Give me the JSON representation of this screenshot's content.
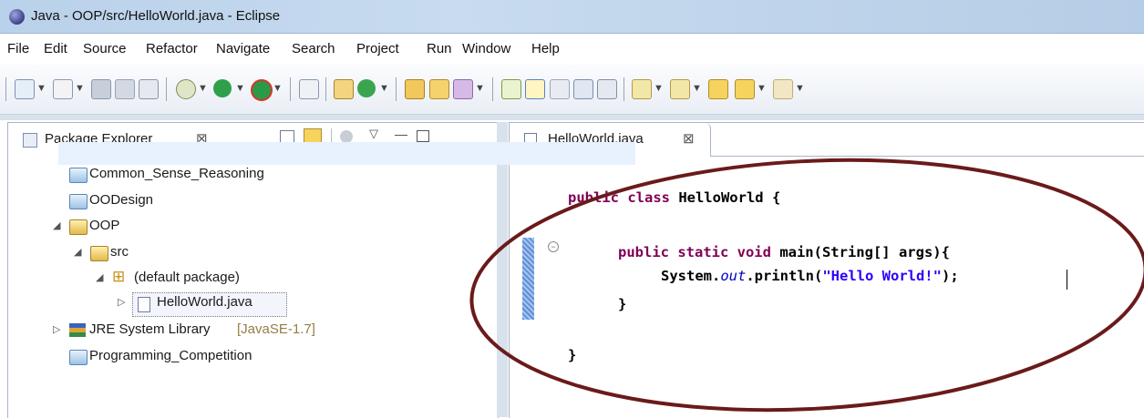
{
  "window": {
    "title": "Java - OOP/src/HelloWorld.java - Eclipse"
  },
  "menu": [
    "File",
    "Edit",
    "Source",
    "Refactor",
    "Navigate",
    "Search",
    "Project",
    "Run",
    "Window",
    "Help"
  ],
  "package_explorer": {
    "tab_label": "Package Explorer",
    "close_glyph": "⊠",
    "tree": [
      {
        "label": "Common_Sense_Reasoning",
        "icon": "folder-icon"
      },
      {
        "label": "OODesign",
        "icon": "folder-icon"
      },
      {
        "label": "OOP",
        "icon": "project-icon"
      },
      {
        "label": "src",
        "icon": "source-folder-icon"
      },
      {
        "label": "(default package)",
        "icon": "package-icon"
      },
      {
        "label": "HelloWorld.java",
        "icon": "java-file-icon"
      },
      {
        "label": "JRE System Library",
        "suffix": "[JavaSE-1.7]",
        "icon": "library-icon"
      },
      {
        "label": "Programming_Competition",
        "icon": "folder-icon"
      }
    ]
  },
  "editor": {
    "tab_label": "HelloWorld.java",
    "close_glyph": "⊠",
    "code": {
      "l1_kw": "public class",
      "l1_rest": " HelloWorld {",
      "l2_kw": "public static void",
      "l2_rest": " main(String[] args){",
      "l3_pre": "System.",
      "l3_field": "out",
      "l3_mid": ".println(",
      "l3_str": "\"Hello World!\"",
      "l3_end": ");",
      "l4": "}",
      "l5": "}"
    }
  },
  "colors": {
    "keyword": "#7f0055",
    "string": "#2a00ff",
    "field": "#0000c0",
    "annotation_ellipse": "#6b1a1a"
  }
}
